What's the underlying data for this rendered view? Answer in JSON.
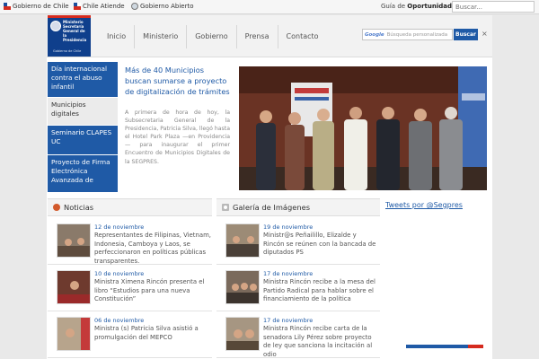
{
  "topbar": {
    "links": [
      {
        "label": "Gobierno de Chile",
        "icon": "chile-flag-icon"
      },
      {
        "label": "Chile Atiende",
        "icon": "chile-flag-icon"
      },
      {
        "label": "Gobierno Abierto",
        "icon": "globe-icon"
      }
    ],
    "guia_prefix": "Guía de ",
    "guia_bold": "Oportunidades",
    "search_placeholder": "Buscar..."
  },
  "header": {
    "logo_lines": "Ministerio Secretaría General de la Presidencia",
    "logo_sub": "Gobierno de Chile",
    "nav": [
      "Inicio",
      "Ministerio",
      "Gobierno",
      "Prensa",
      "Contacto"
    ],
    "search": {
      "google_label": "Google",
      "placeholder": "Búsqueda personalizada",
      "button": "Buscar",
      "close": "×"
    }
  },
  "menu": [
    {
      "label": "Día internacional contra el abuso infantil",
      "active": true
    },
    {
      "label": "Municipios digitales",
      "active": false
    },
    {
      "label": "Seminario CLAPES UC",
      "active": true
    },
    {
      "label": "Proyecto de Firma Electrónica Avanzada de",
      "active": true
    }
  ],
  "featured": {
    "title": "Más de 40 Municipios buscan sumarse a proyecto de digitalización de trámites",
    "body": "A primera de hora de hoy, la Subsecretaria General de la Presidencia, Patricia Silva, llegó hasta el Hotel Park Plaza —en Providencia— para inaugurar el primer Encuentro de Municipios Digitales de la SEGPRES."
  },
  "noticias": {
    "title": "Noticias",
    "items": [
      {
        "date": "12 de noviembre",
        "text": "Representantes de Filipinas, Vietnam, Indonesia, Camboya y Laos, se perfeccionaron en políticas públicas transparentes."
      },
      {
        "date": "10 de noviembre",
        "text": "Ministra Ximena Rincón presenta el libro “Estudios para una nueva Constitución”"
      },
      {
        "date": "06 de noviembre",
        "text": "Ministra (s) Patricia Silva asistió a promulgación del MEPCO"
      }
    ]
  },
  "galeria": {
    "title": "Galería de Imágenes",
    "items": [
      {
        "date": "19 de noviembre",
        "text": "Ministr@s Peñailillo, Elizalde y Rincón se reúnen con la bancada de diputados PS"
      },
      {
        "date": "17 de noviembre",
        "text": "Ministra Rincón recibe a la mesa del Partido Radical para hablar sobre el financiamiento de la política"
      },
      {
        "date": "17 de noviembre",
        "text": "Ministra Rincón recibe carta de la senadora Lily Pérez sobre proyecto de ley que sanciona la incitación al odio"
      }
    ]
  },
  "tweets": "Tweets por @Segpres",
  "colors": {
    "accent": "#1f5aa6",
    "red": "#d52b1e",
    "background": "#e9e9e9"
  }
}
